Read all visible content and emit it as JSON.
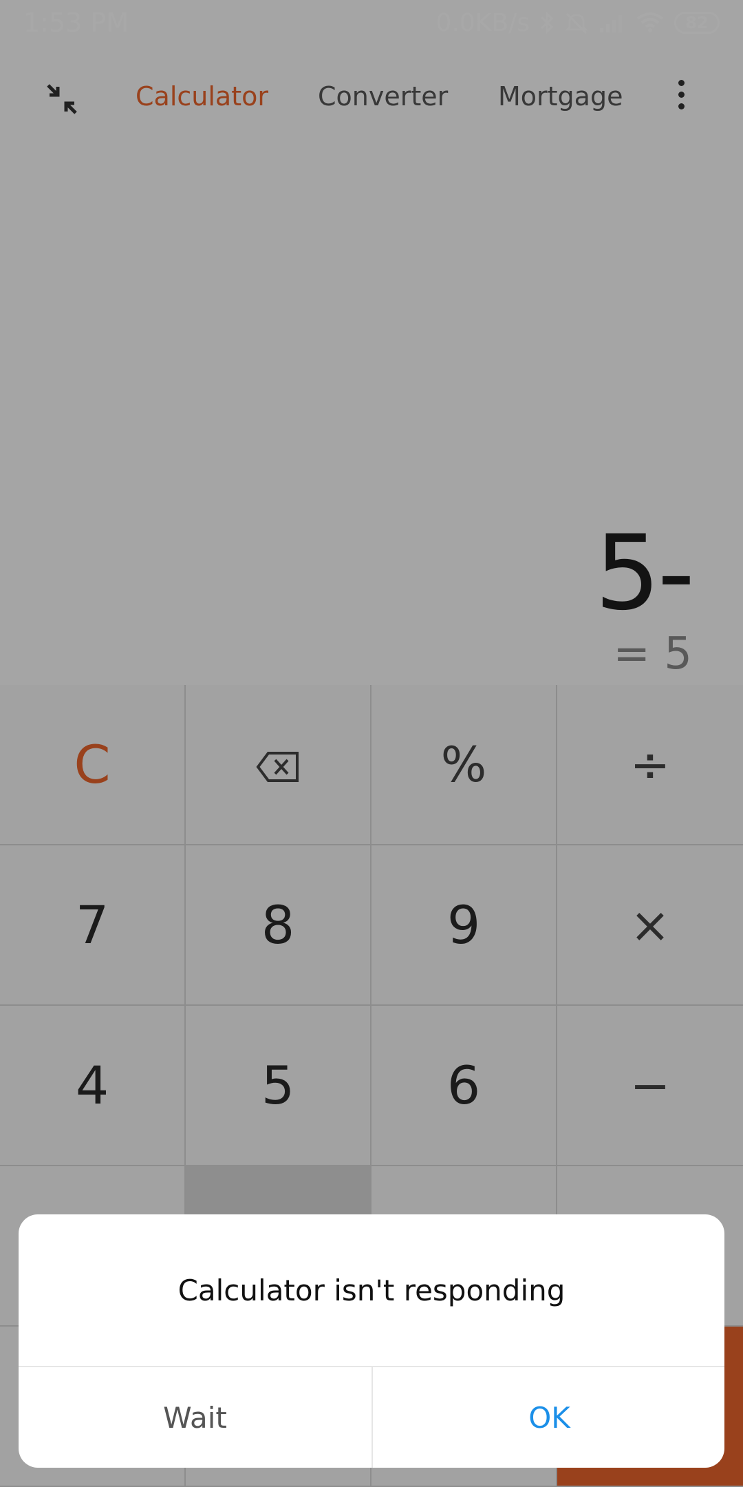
{
  "status_bar": {
    "time": "1:53 PM",
    "network_speed": "0.0KB/s",
    "battery": "82",
    "icons": [
      "bluetooth-icon",
      "mute-icon",
      "signal-icon",
      "wifi-icon",
      "battery-icon"
    ]
  },
  "tabs": {
    "calculator": "Calculator",
    "converter": "Converter",
    "mortgage": "Mortgage"
  },
  "display": {
    "expression": "5-",
    "result": "= 5"
  },
  "keys": {
    "clear": "C",
    "percent": "%",
    "divide": "÷",
    "seven": "7",
    "eight": "8",
    "nine": "9",
    "multiply": "×",
    "four": "4",
    "five": "5",
    "six": "6",
    "minus": "−"
  },
  "dialog": {
    "title": "Calculator isn't responding",
    "wait_label": "Wait",
    "ok_label": "OK"
  },
  "colors": {
    "accent": "#e8632b",
    "dialog_ok": "#1b8fe8"
  }
}
